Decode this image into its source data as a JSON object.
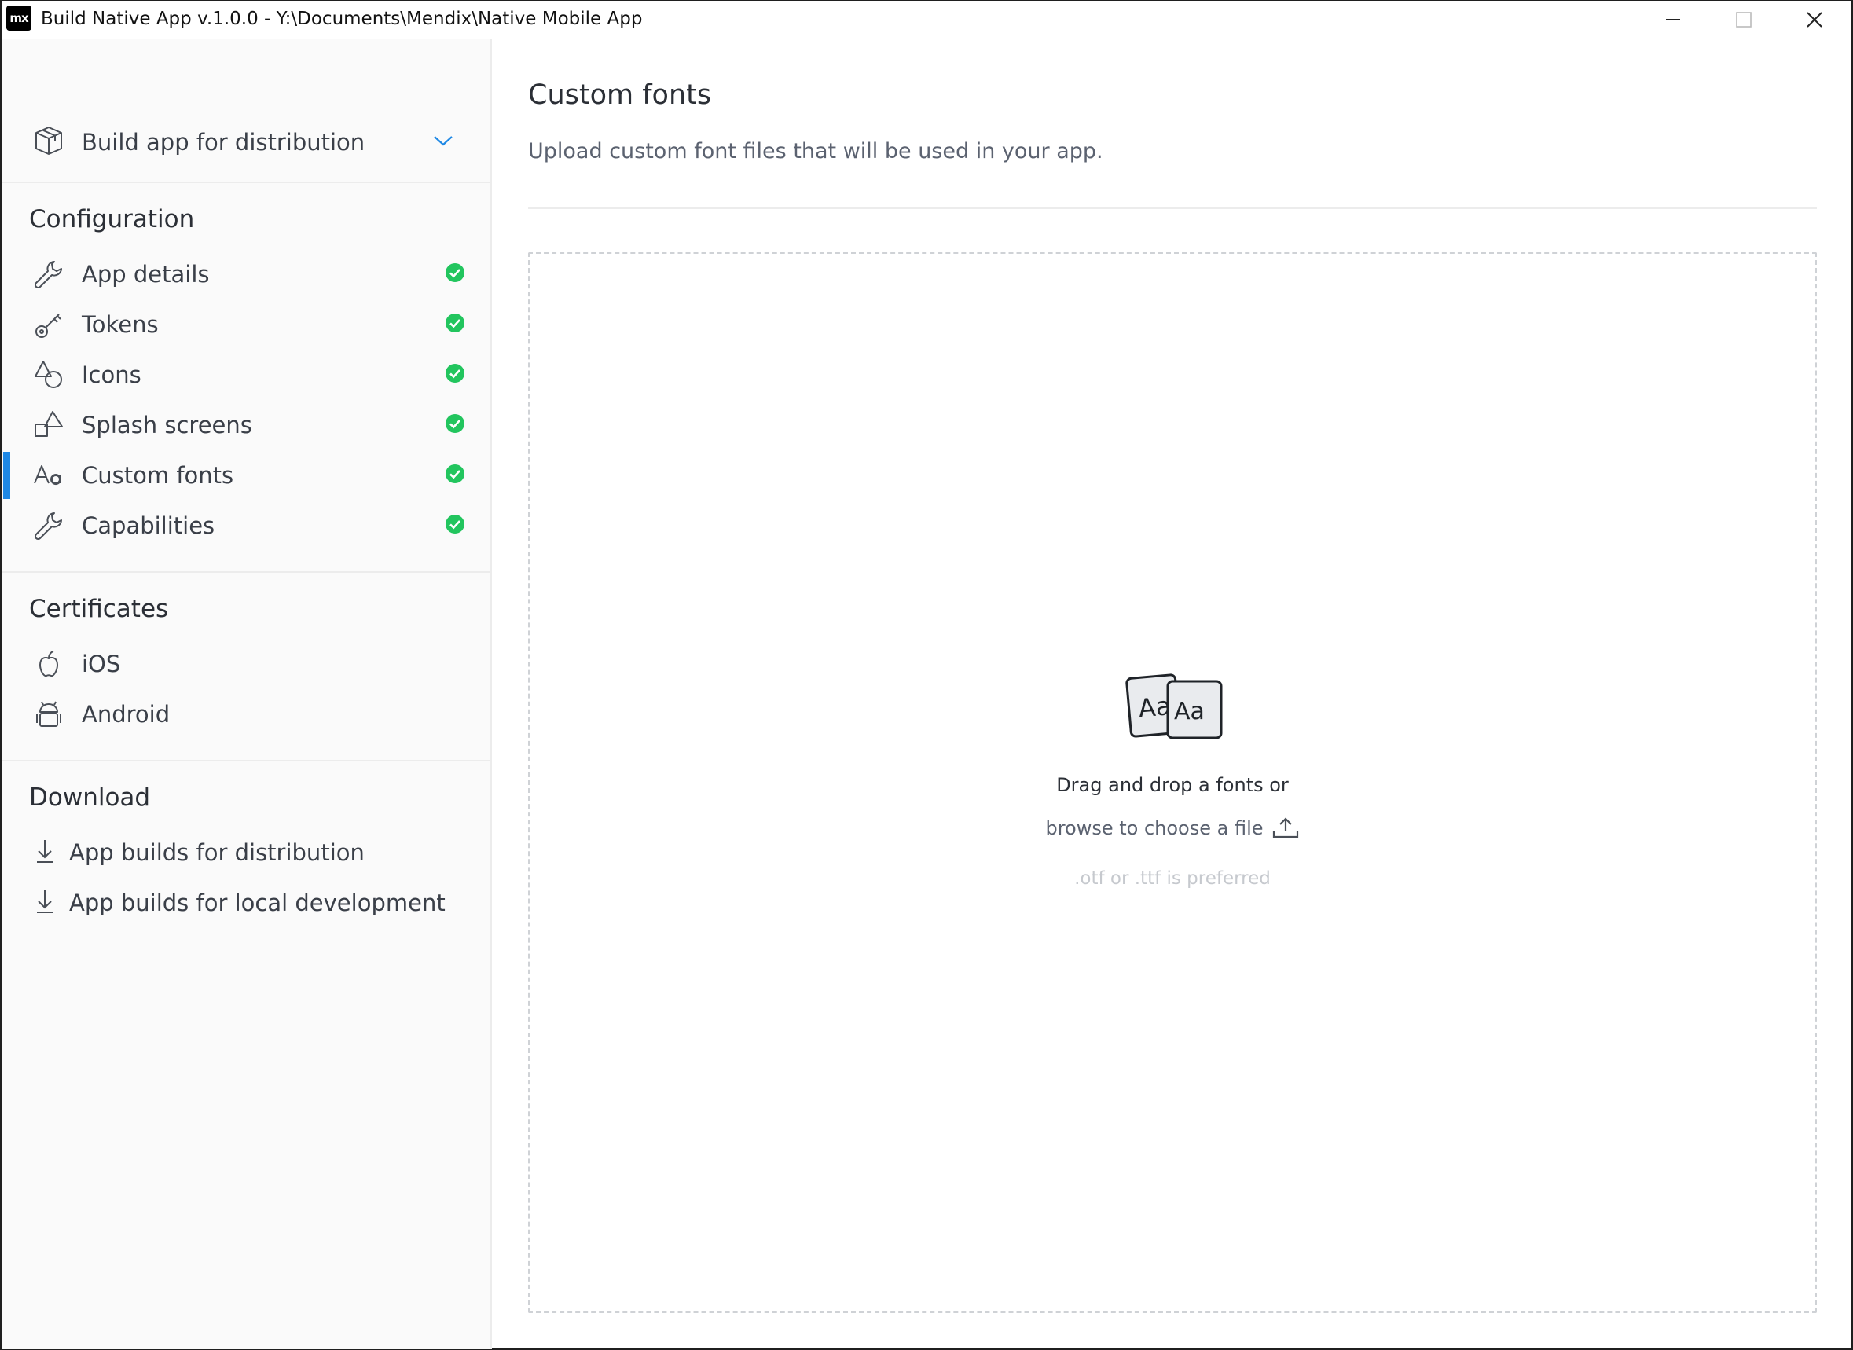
{
  "window": {
    "title": "Build Native App v.1.0.0 - Y:\\Documents\\Mendix\\Native Mobile App",
    "logo_text": "mx"
  },
  "sidebar": {
    "build_selector": {
      "label": "Build app for distribution",
      "icon": "box-icon"
    },
    "configuration": {
      "title": "Configuration",
      "items": [
        {
          "label": "App details",
          "icon": "wrench-icon",
          "status": "complete"
        },
        {
          "label": "Tokens",
          "icon": "key-icon",
          "status": "complete"
        },
        {
          "label": "Icons",
          "icon": "shapes-icon",
          "status": "complete"
        },
        {
          "label": "Splash screens",
          "icon": "splash-icon",
          "status": "complete"
        },
        {
          "label": "Custom fonts",
          "icon": "font-icon",
          "status": "complete",
          "active": true
        },
        {
          "label": "Capabilities",
          "icon": "wrench-icon",
          "status": "complete"
        }
      ]
    },
    "certificates": {
      "title": "Certificates",
      "items": [
        {
          "label": "iOS",
          "icon": "apple-icon"
        },
        {
          "label": "Android",
          "icon": "android-icon"
        }
      ]
    },
    "download": {
      "title": "Download",
      "items": [
        {
          "label": "App builds for distribution",
          "icon": "download-icon"
        },
        {
          "label": "App builds for local development",
          "icon": "download-icon"
        }
      ]
    }
  },
  "main": {
    "title": "Custom fonts",
    "subtitle": "Upload custom font files that will be used in your app.",
    "dropzone": {
      "illustration_text": "Aa",
      "line1": "Drag and drop a fonts or",
      "browse_label": "browse to choose a file",
      "hint": ".otf or .ttf is preferred"
    }
  },
  "colors": {
    "accent": "#1e88e5",
    "status_ok": "#22c55e",
    "sidebar_bg": "#fafafa"
  }
}
